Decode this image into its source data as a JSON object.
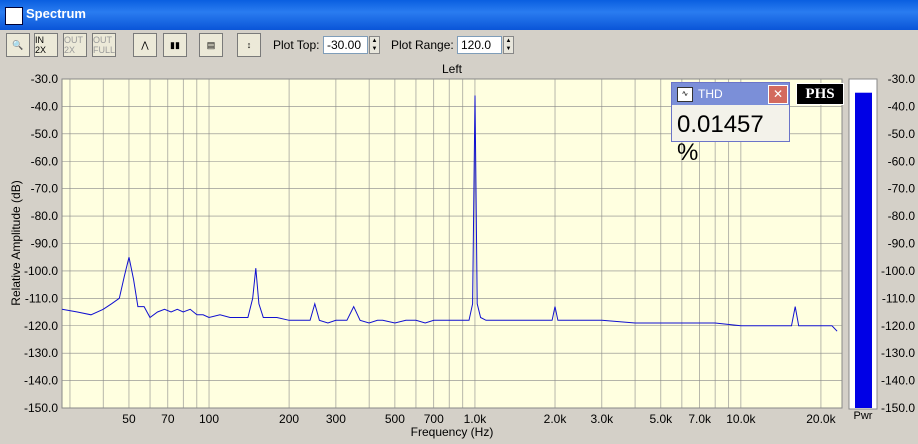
{
  "window": {
    "title": "Spectrum"
  },
  "toolbar": {
    "buttons": [
      {
        "name": "zoom-button",
        "icon": "magnifier-icon",
        "label": "",
        "enabled": true
      },
      {
        "name": "zoom-in-2x-button",
        "icon": "zoom-in-icon",
        "label": "IN 2X",
        "enabled": true
      },
      {
        "name": "zoom-out-2x-button",
        "icon": "zoom-out-icon",
        "label": "OUT 2X",
        "enabled": false
      },
      {
        "name": "zoom-out-full-button",
        "icon": "zoom-full-icon",
        "label": "OUT FULL",
        "enabled": false
      },
      {
        "name": "line-graph-button",
        "icon": "line-graph-icon",
        "label": "",
        "enabled": true
      },
      {
        "name": "bar-graph-button",
        "icon": "bar-graph-icon",
        "label": "",
        "enabled": true
      },
      {
        "name": "settings-panel-button",
        "icon": "panel-icon",
        "label": "",
        "enabled": true
      },
      {
        "name": "auto-scale-button",
        "icon": "vertical-arrows-icon",
        "label": "",
        "enabled": true
      }
    ],
    "plot_top_label": "Plot Top:",
    "plot_top_value": "-30.00",
    "plot_range_label": "Plot Range:",
    "plot_range_value": "120.0"
  },
  "thd_window": {
    "title": "THD",
    "value": "0.01457 %"
  },
  "logo": "PHS",
  "chart_data": {
    "type": "line",
    "title": "Left",
    "xlabel": "Frequency (Hz)",
    "ylabel": "Relative Amplitude (dB)",
    "x_scale": "log",
    "xlim": [
      28,
      24000
    ],
    "ylim": [
      -150,
      -30
    ],
    "grid": true,
    "background": "#ffffe0",
    "line_color": "#1010d0",
    "x_ticks": [
      50,
      70,
      100,
      200,
      300,
      500,
      700,
      1000,
      2000,
      3000,
      5000,
      7000,
      10000,
      20000
    ],
    "x_tick_labels": [
      "50",
      "70",
      "100",
      "200",
      "300",
      "500",
      "700",
      "1.0k",
      "2.0k",
      "3.0k",
      "5.0k",
      "7.0k",
      "10.0k",
      "20.0k"
    ],
    "y_ticks": [
      -30,
      -40,
      -50,
      -60,
      -70,
      -80,
      -90,
      -100,
      -110,
      -120,
      -130,
      -140,
      -150
    ],
    "y_tick_labels": [
      "-30.0",
      "-40.0",
      "-50.0",
      "-60.0",
      "-70.0",
      "-80.0",
      "-90.0",
      "-100.0",
      "-110.0",
      "-120.0",
      "-130.0",
      "-140.0",
      "-150.0"
    ],
    "series": [
      {
        "x": [
          28,
          32,
          36,
          40,
          43,
          46,
          48,
          50,
          52,
          54,
          57,
          60,
          64,
          68,
          72,
          76,
          80,
          85,
          90,
          95,
          100,
          110,
          120,
          130,
          140,
          146,
          150,
          154,
          160,
          180,
          200,
          220,
          240,
          250,
          260,
          280,
          300,
          330,
          350,
          370,
          400,
          430,
          450,
          500,
          550,
          600,
          650,
          700,
          800,
          900,
          950,
          980,
          1000,
          1020,
          1050,
          1100,
          1300,
          1500,
          1800,
          1950,
          2000,
          2050,
          2200,
          2600,
          3000,
          4000,
          5000,
          6000,
          8000,
          10000,
          12000,
          14000,
          15500,
          16000,
          16500,
          17500,
          20000,
          22000,
          23000
        ],
        "y": [
          -114,
          -115,
          -116,
          -114,
          -112,
          -110,
          -102,
          -95,
          -103,
          -113,
          -113,
          -117,
          -115,
          -114,
          -115,
          -114,
          -115,
          -114,
          -116,
          -116,
          -117,
          -116,
          -117,
          -117,
          -117,
          -110,
          -99,
          -112,
          -117,
          -117,
          -118,
          -118,
          -118,
          -112,
          -118,
          -119,
          -118,
          -118,
          -113,
          -118,
          -119,
          -118,
          -118,
          -119,
          -118,
          -118,
          -119,
          -118,
          -118,
          -118,
          -118,
          -112,
          -36,
          -112,
          -117,
          -118,
          -118,
          -118,
          -118,
          -118,
          -113,
          -118,
          -118,
          -118,
          -118,
          -119,
          -119,
          -119,
          -119,
          -120,
          -120,
          -120,
          -120,
          -113,
          -120,
          -120,
          -120,
          -120,
          -122
        ]
      }
    ],
    "pwr_meter": {
      "label": "Pwr",
      "value": -35,
      "range": [
        -150,
        -30
      ],
      "color": "#0000e6"
    }
  }
}
